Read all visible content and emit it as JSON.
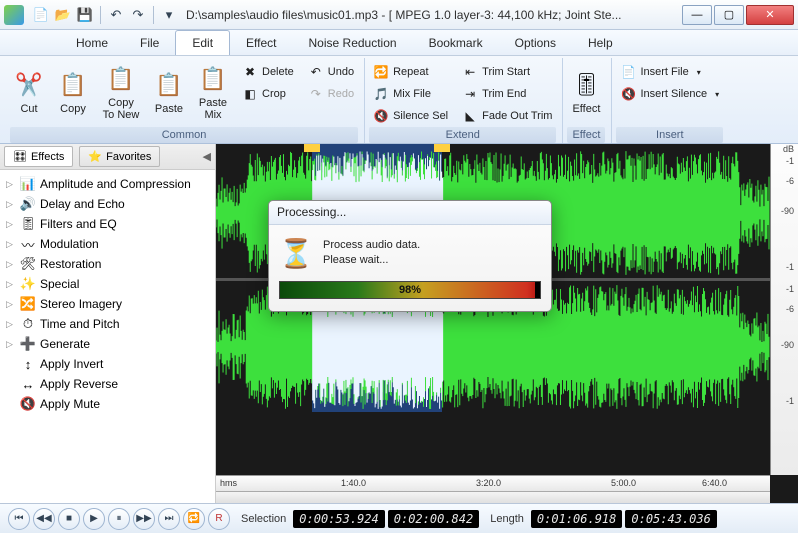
{
  "title": "D:\\samples\\audio files\\music01.mp3 - [ MPEG 1.0 layer-3: 44,100 kHz; Joint Ste...",
  "menu": [
    "Home",
    "File",
    "Edit",
    "Effect",
    "Noise Reduction",
    "Bookmark",
    "Options",
    "Help"
  ],
  "menu_active_index": 2,
  "ribbon": {
    "common": {
      "label": "Common",
      "big": [
        {
          "name": "cut",
          "label": "Cut"
        },
        {
          "name": "copy",
          "label": "Copy"
        },
        {
          "name": "copy-to-new",
          "label": "Copy\nTo New"
        },
        {
          "name": "paste",
          "label": "Paste"
        },
        {
          "name": "paste-mix",
          "label": "Paste\nMix"
        }
      ],
      "small": [
        {
          "name": "delete",
          "label": "Delete"
        },
        {
          "name": "crop",
          "label": "Crop"
        },
        {
          "name": "undo",
          "label": "Undo"
        },
        {
          "name": "redo",
          "label": "Redo"
        }
      ]
    },
    "extend": {
      "label": "Extend",
      "small": [
        {
          "name": "repeat",
          "label": "Repeat"
        },
        {
          "name": "mix-file",
          "label": "Mix File"
        },
        {
          "name": "silence-sel",
          "label": "Silence Sel"
        },
        {
          "name": "trim-start",
          "label": "Trim Start"
        },
        {
          "name": "trim-end",
          "label": "Trim End"
        },
        {
          "name": "fade-out-trim",
          "label": "Fade Out Trim"
        }
      ]
    },
    "effect": {
      "label": "Effect",
      "big": {
        "name": "effect",
        "label": "Effect"
      }
    },
    "insert": {
      "label": "Insert",
      "small": [
        {
          "name": "insert-file",
          "label": "Insert File"
        },
        {
          "name": "insert-silence",
          "label": "Insert Silence"
        }
      ]
    }
  },
  "sidebar": {
    "tabs": [
      "Effects",
      "Favorites"
    ],
    "items": [
      "Amplitude and Compression",
      "Delay and Echo",
      "Filters and EQ",
      "Modulation",
      "Restoration",
      "Special",
      "Stereo Imagery",
      "Time and Pitch",
      "Generate",
      "Apply Invert",
      "Apply Reverse",
      "Apply Mute"
    ]
  },
  "db_scale": {
    "label": "dB",
    "ticks": [
      "-1",
      "-6",
      "-90",
      "-1",
      "-1",
      "-6",
      "-90",
      "-1"
    ]
  },
  "timeline": {
    "unit": "hms",
    "ticks": [
      "1:40.0",
      "3:20.0",
      "5:00.0",
      "6:40.0"
    ]
  },
  "transport": {
    "selection_label": "Selection",
    "length_label": "Length",
    "sel_start": "0:00:53.924",
    "sel_end": "0:02:00.842",
    "len_a": "0:01:06.918",
    "len_b": "0:05:43.036"
  },
  "dialog": {
    "title": "Processing...",
    "line1": "Process audio data.",
    "line2": "Please wait...",
    "percent": "98%"
  }
}
